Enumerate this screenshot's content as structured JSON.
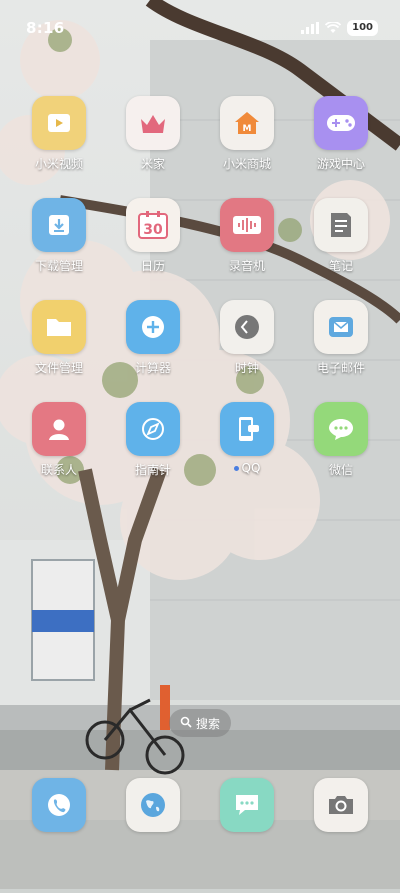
{
  "status_bar": {
    "time": "8:16",
    "battery": "100"
  },
  "apps": [
    {
      "label": "小米视频"
    },
    {
      "label": "米家"
    },
    {
      "label": "小米商城"
    },
    {
      "label": "游戏中心"
    },
    {
      "label": "下载管理"
    },
    {
      "label": "日历"
    },
    {
      "label": "录音机"
    },
    {
      "label": "笔记"
    },
    {
      "label": "文件管理"
    },
    {
      "label": "计算器"
    },
    {
      "label": "时钟"
    },
    {
      "label": "电子邮件"
    },
    {
      "label": "联系人"
    },
    {
      "label": "指南针"
    },
    {
      "label": "QQ"
    },
    {
      "label": "微信"
    }
  ],
  "calendar_day": "30",
  "search": {
    "label": "搜索"
  },
  "icons": {
    "colors": {
      "video": "#f1d27a",
      "mijia": "#f6f0ee",
      "mall": "#f3f0ec",
      "game": "#a890f0",
      "download": "#6fb4e6",
      "calendar": "#f6f1ec",
      "recorder": "#e27883",
      "notes": "#f2f0eb",
      "files": "#f1d06d",
      "calculator": "#5fb2ea",
      "clock": "#f2f0ec",
      "email": "#f3f0eb",
      "contacts": "#e47883",
      "compass": "#5fb2ea",
      "qq": "#5fb2ea",
      "wechat": "#94d97a",
      "phone": "#6fb4e6",
      "browser": "#f2f0ec",
      "messages": "#88d9c3",
      "camera": "#f3f0ec"
    }
  }
}
